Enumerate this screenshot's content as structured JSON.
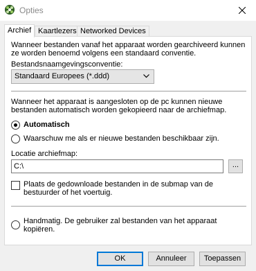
{
  "window": {
    "title": "Opties",
    "close_glyph": "✕"
  },
  "tabs": [
    {
      "label": "Archief",
      "active": true
    },
    {
      "label": "Kaartlezers",
      "active": false
    },
    {
      "label": "Networked Devices",
      "active": false
    }
  ],
  "archief": {
    "intro_line1": "Wanneer bestanden vanaf het apparaat worden gearchiveerd kunnen",
    "intro_line2": "ze worden benoemd volgens een standaard conventie.",
    "naming_label": "Bestandsnaamgevingsconventie:",
    "naming_selected": "Standaard Europees (*.ddd)",
    "connect_line1": "Wanneer het apparaat is aangesloten op de pc kunnen nieuwe",
    "connect_line2": "bestanden automatisch worden gekopieerd naar de archiefmap.",
    "radio_auto_label": "Automatisch",
    "radio_auto_selected": true,
    "radio_warn_label": "Waarschuw me als er nieuwe bestanden beschikbaar zijn.",
    "radio_warn_selected": false,
    "location_label": "Locatie archiefmap:",
    "location_value": "C:\\",
    "browse_label": "...",
    "checkbox_line1": "Plaats de gedownloade bestanden in de submap van de",
    "checkbox_line2": "bestuurder of het voertuig.",
    "checkbox_checked": false,
    "radio_manual_line1": "Handmatig. De gebruiker zal bestanden van het apparaat",
    "radio_manual_line2": "kopiëren.",
    "radio_manual_selected": false
  },
  "buttons": {
    "ok": "OK",
    "cancel": "Annuleer",
    "apply": "Toepassen"
  },
  "colors": {
    "accent": "#0078d7",
    "title_text": "#8a8a8a",
    "panel_bg": "#ffffff",
    "window_bg": "#f0f0f0"
  }
}
